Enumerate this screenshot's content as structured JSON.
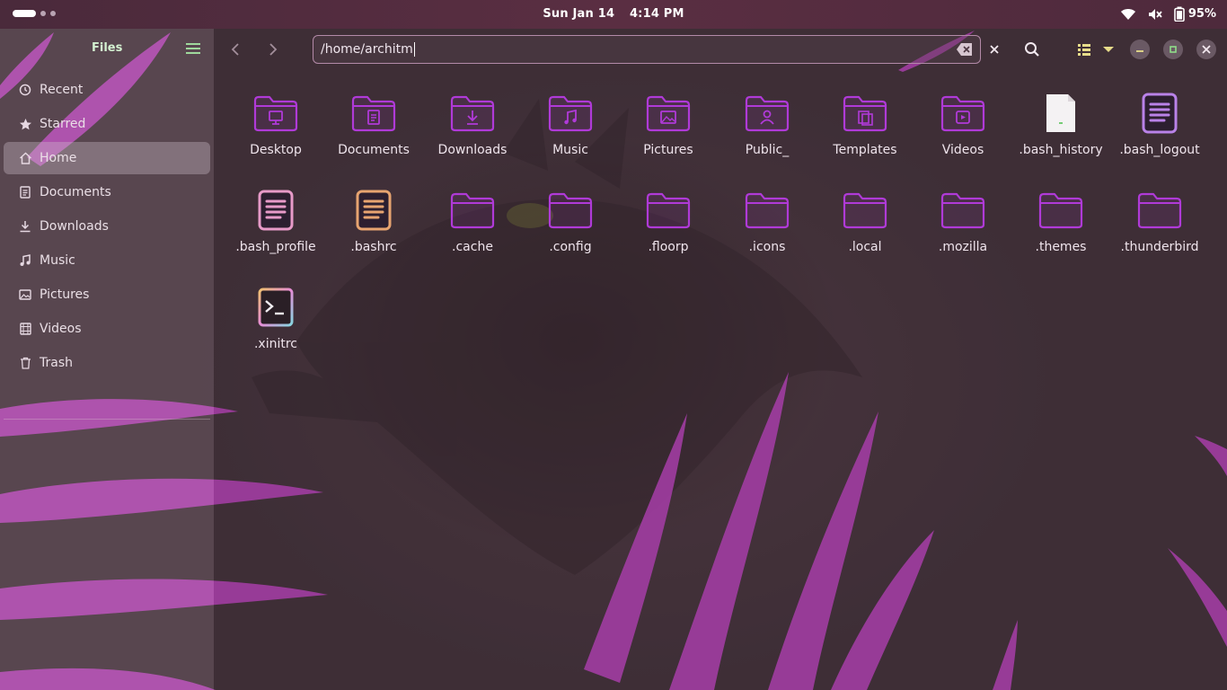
{
  "topbar": {
    "date": "Sun Jan 14",
    "time": "4:14 PM",
    "battery": "95%",
    "icons": [
      "wifi-icon",
      "volume-muted-icon",
      "battery-icon"
    ]
  },
  "sidebar": {
    "title": "Files",
    "items": [
      {
        "label": "Recent",
        "icon": "clock-icon"
      },
      {
        "label": "Starred",
        "icon": "star-icon"
      },
      {
        "label": "Home",
        "icon": "home-icon",
        "active": true
      },
      {
        "label": "Documents",
        "icon": "document-icon"
      },
      {
        "label": "Downloads",
        "icon": "download-icon"
      },
      {
        "label": "Music",
        "icon": "music-icon"
      },
      {
        "label": "Pictures",
        "icon": "picture-icon"
      },
      {
        "label": "Videos",
        "icon": "film-icon"
      },
      {
        "label": "Trash",
        "icon": "trash-icon"
      }
    ]
  },
  "header": {
    "path": "/home/architm"
  },
  "files": [
    {
      "name": "Desktop",
      "type": "folder-desktop"
    },
    {
      "name": "Documents",
      "type": "folder-documents"
    },
    {
      "name": "Downloads",
      "type": "folder-downloads"
    },
    {
      "name": "Music",
      "type": "folder-music"
    },
    {
      "name": "Pictures",
      "type": "folder-pictures"
    },
    {
      "name": "Public_",
      "type": "folder-public"
    },
    {
      "name": "Templates",
      "type": "folder-templates"
    },
    {
      "name": "Videos",
      "type": "folder-videos"
    },
    {
      "name": ".bash_history",
      "type": "file-blank"
    },
    {
      "name": ".bash_logout",
      "type": "file-text-purple"
    },
    {
      "name": ".bash_profile",
      "type": "file-text-pink"
    },
    {
      "name": ".bashrc",
      "type": "file-text-orange"
    },
    {
      "name": ".cache",
      "type": "folder"
    },
    {
      "name": ".config",
      "type": "folder"
    },
    {
      "name": ".floorp",
      "type": "folder"
    },
    {
      "name": ".icons",
      "type": "folder"
    },
    {
      "name": ".local",
      "type": "folder"
    },
    {
      "name": ".mozilla",
      "type": "folder"
    },
    {
      "name": ".themes",
      "type": "folder"
    },
    {
      "name": ".thunderbird",
      "type": "folder"
    },
    {
      "name": ".xinitrc",
      "type": "file-script"
    }
  ],
  "colors": {
    "folder": "#b03ad8",
    "accent": "#c46ee0"
  }
}
